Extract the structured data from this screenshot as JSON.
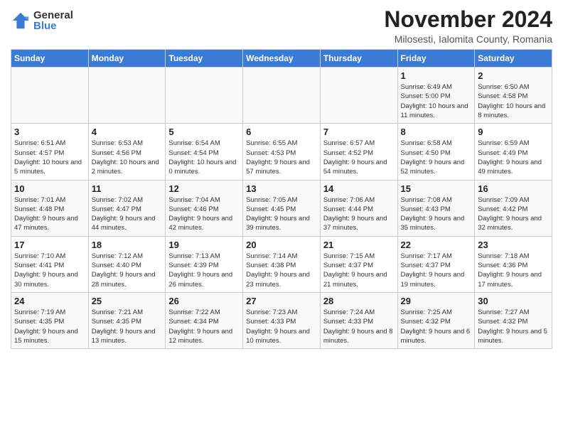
{
  "header": {
    "logo_general": "General",
    "logo_blue": "Blue",
    "month_title": "November 2024",
    "location": "Milosesti, Ialomita County, Romania"
  },
  "days_of_week": [
    "Sunday",
    "Monday",
    "Tuesday",
    "Wednesday",
    "Thursday",
    "Friday",
    "Saturday"
  ],
  "weeks": [
    [
      {
        "day": "",
        "info": ""
      },
      {
        "day": "",
        "info": ""
      },
      {
        "day": "",
        "info": ""
      },
      {
        "day": "",
        "info": ""
      },
      {
        "day": "",
        "info": ""
      },
      {
        "day": "1",
        "info": "Sunrise: 6:49 AM\nSunset: 5:00 PM\nDaylight: 10 hours and 11 minutes."
      },
      {
        "day": "2",
        "info": "Sunrise: 6:50 AM\nSunset: 4:58 PM\nDaylight: 10 hours and 8 minutes."
      }
    ],
    [
      {
        "day": "3",
        "info": "Sunrise: 6:51 AM\nSunset: 4:57 PM\nDaylight: 10 hours and 5 minutes."
      },
      {
        "day": "4",
        "info": "Sunrise: 6:53 AM\nSunset: 4:56 PM\nDaylight: 10 hours and 2 minutes."
      },
      {
        "day": "5",
        "info": "Sunrise: 6:54 AM\nSunset: 4:54 PM\nDaylight: 10 hours and 0 minutes."
      },
      {
        "day": "6",
        "info": "Sunrise: 6:55 AM\nSunset: 4:53 PM\nDaylight: 9 hours and 57 minutes."
      },
      {
        "day": "7",
        "info": "Sunrise: 6:57 AM\nSunset: 4:52 PM\nDaylight: 9 hours and 54 minutes."
      },
      {
        "day": "8",
        "info": "Sunrise: 6:58 AM\nSunset: 4:50 PM\nDaylight: 9 hours and 52 minutes."
      },
      {
        "day": "9",
        "info": "Sunrise: 6:59 AM\nSunset: 4:49 PM\nDaylight: 9 hours and 49 minutes."
      }
    ],
    [
      {
        "day": "10",
        "info": "Sunrise: 7:01 AM\nSunset: 4:48 PM\nDaylight: 9 hours and 47 minutes."
      },
      {
        "day": "11",
        "info": "Sunrise: 7:02 AM\nSunset: 4:47 PM\nDaylight: 9 hours and 44 minutes."
      },
      {
        "day": "12",
        "info": "Sunrise: 7:04 AM\nSunset: 4:46 PM\nDaylight: 9 hours and 42 minutes."
      },
      {
        "day": "13",
        "info": "Sunrise: 7:05 AM\nSunset: 4:45 PM\nDaylight: 9 hours and 39 minutes."
      },
      {
        "day": "14",
        "info": "Sunrise: 7:06 AM\nSunset: 4:44 PM\nDaylight: 9 hours and 37 minutes."
      },
      {
        "day": "15",
        "info": "Sunrise: 7:08 AM\nSunset: 4:43 PM\nDaylight: 9 hours and 35 minutes."
      },
      {
        "day": "16",
        "info": "Sunrise: 7:09 AM\nSunset: 4:42 PM\nDaylight: 9 hours and 32 minutes."
      }
    ],
    [
      {
        "day": "17",
        "info": "Sunrise: 7:10 AM\nSunset: 4:41 PM\nDaylight: 9 hours and 30 minutes."
      },
      {
        "day": "18",
        "info": "Sunrise: 7:12 AM\nSunset: 4:40 PM\nDaylight: 9 hours and 28 minutes."
      },
      {
        "day": "19",
        "info": "Sunrise: 7:13 AM\nSunset: 4:39 PM\nDaylight: 9 hours and 26 minutes."
      },
      {
        "day": "20",
        "info": "Sunrise: 7:14 AM\nSunset: 4:38 PM\nDaylight: 9 hours and 23 minutes."
      },
      {
        "day": "21",
        "info": "Sunrise: 7:15 AM\nSunset: 4:37 PM\nDaylight: 9 hours and 21 minutes."
      },
      {
        "day": "22",
        "info": "Sunrise: 7:17 AM\nSunset: 4:37 PM\nDaylight: 9 hours and 19 minutes."
      },
      {
        "day": "23",
        "info": "Sunrise: 7:18 AM\nSunset: 4:36 PM\nDaylight: 9 hours and 17 minutes."
      }
    ],
    [
      {
        "day": "24",
        "info": "Sunrise: 7:19 AM\nSunset: 4:35 PM\nDaylight: 9 hours and 15 minutes."
      },
      {
        "day": "25",
        "info": "Sunrise: 7:21 AM\nSunset: 4:35 PM\nDaylight: 9 hours and 13 minutes."
      },
      {
        "day": "26",
        "info": "Sunrise: 7:22 AM\nSunset: 4:34 PM\nDaylight: 9 hours and 12 minutes."
      },
      {
        "day": "27",
        "info": "Sunrise: 7:23 AM\nSunset: 4:33 PM\nDaylight: 9 hours and 10 minutes."
      },
      {
        "day": "28",
        "info": "Sunrise: 7:24 AM\nSunset: 4:33 PM\nDaylight: 9 hours and 8 minutes."
      },
      {
        "day": "29",
        "info": "Sunrise: 7:25 AM\nSunset: 4:32 PM\nDaylight: 9 hours and 6 minutes."
      },
      {
        "day": "30",
        "info": "Sunrise: 7:27 AM\nSunset: 4:32 PM\nDaylight: 9 hours and 5 minutes."
      }
    ]
  ]
}
